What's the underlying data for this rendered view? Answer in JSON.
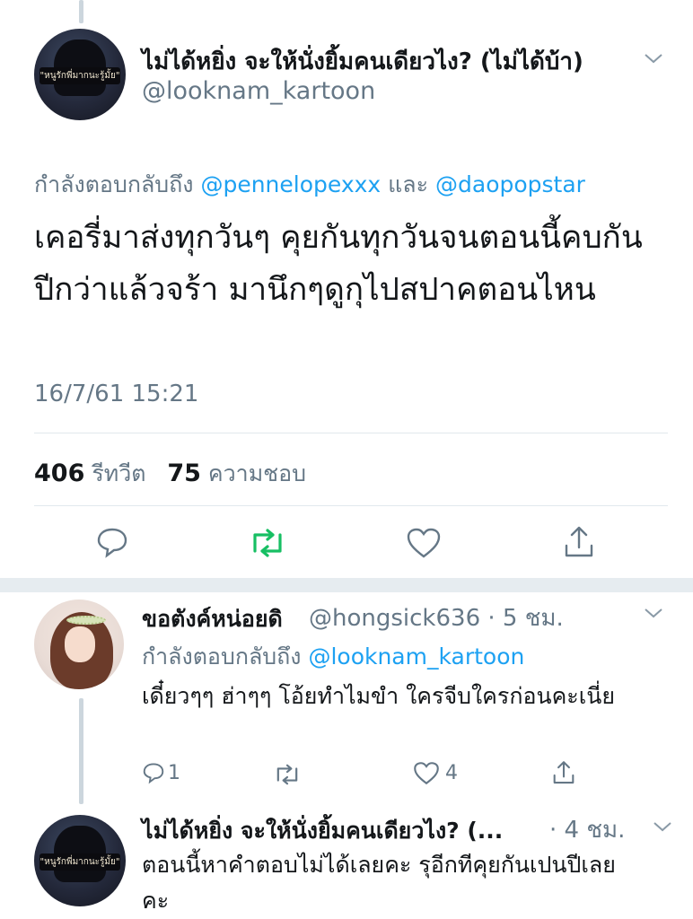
{
  "main_tweet": {
    "avatar_text": "\"หนูรักพี่มากนะรู้มั้ย\"",
    "display_name": "ไม่ได้หยิ่ง จะให้นั่งยิ้มคนเดียวไง? (ไม่ได้บ้า)",
    "handle": "@looknam_kartoon",
    "replying_prefix": "กำลังตอบกลับถึง",
    "replying_user1": "@pennelopexxx",
    "replying_and": "และ",
    "replying_user2": "@daopopstar",
    "text": "เคอรี่มาส่งทุกวันๆ คุยกันทุกวันจนตอนนี้คบกัน ปีกว่าแล้วจร้า มานึกๆดูกุไปสปาคตอนไหน",
    "timestamp": "16/7/61 15:21",
    "retweet_count": "406",
    "retweet_label": "รีทวีต",
    "like_count": "75",
    "like_label": "ความชอบ"
  },
  "reply1": {
    "display_name": "ขอตังค์หน่อยดิ",
    "handle": "@hongsick636",
    "time": "· 5 ชม.",
    "replying_prefix": "กำลังตอบกลับถึง",
    "replying_user": "@looknam_kartoon",
    "text": "เดี๋ยวๆๆ ฮ่าๆๆ โอ้ยทำไมขำ ใครจีบใครก่อนคะเนี่ย",
    "reply_count": "1",
    "like_count": "4"
  },
  "reply2": {
    "avatar_text": "\"หนูรักพี่มากนะรู้มั้ย\"",
    "display_name": "ไม่ได้หยิ่ง จะให้นั่งยิ้มคนเดียวไง? (...",
    "time": "· 4 ชม.",
    "text": "ตอนนี้หาคำตอบไม่ได้เลยคะ รุอีกทีคุยกันเปนปีเลยคะ"
  },
  "icons": {
    "reply": "reply-icon",
    "retweet": "retweet-icon",
    "like": "heart-icon",
    "share": "share-icon",
    "more": "chevron-down-icon"
  },
  "colors": {
    "link": "#1da1f2",
    "retweet_active": "#17bf63",
    "muted": "#657786",
    "separator": "#e6ecf0"
  }
}
